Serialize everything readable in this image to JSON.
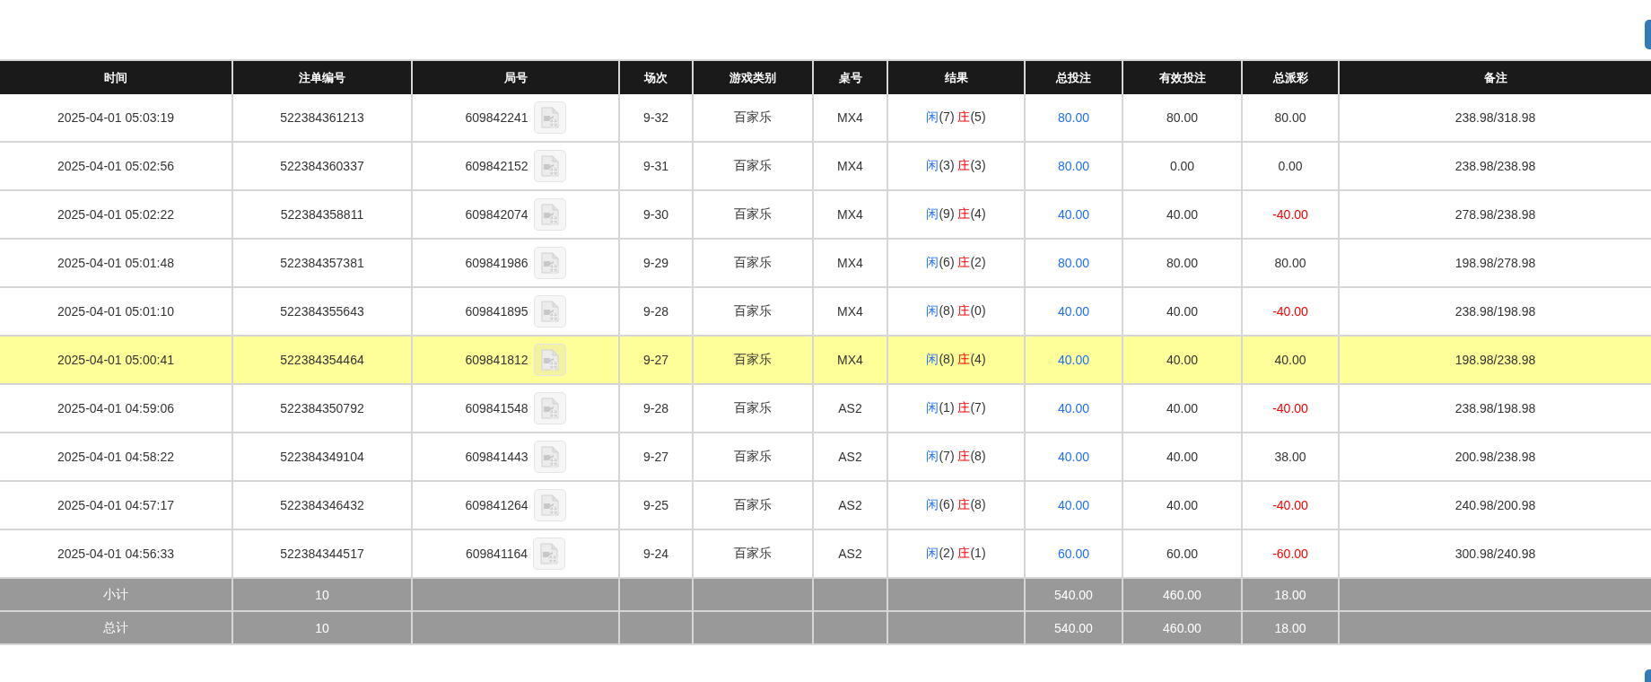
{
  "table": {
    "columns": [
      "时间",
      "注单编号",
      "局号",
      "场次",
      "游戏类别",
      "桌号",
      "结果",
      "总投注",
      "有效投注",
      "总派彩",
      "备注"
    ],
    "rows": [
      {
        "time": "2025-04-01 05:03:19",
        "bet_id": "522384361213",
        "round": "609842241",
        "session": "9-32",
        "game": "百家乐",
        "table": "MX4",
        "player": "闲",
        "player_points": "(7)",
        "banker": "庄",
        "banker_points": "(5)",
        "total_bet": "80.00",
        "valid_bet": "80.00",
        "payout": "80.00",
        "payout_negative": false,
        "note": "238.98/318.98",
        "selected": false
      },
      {
        "time": "2025-04-01 05:02:56",
        "bet_id": "522384360337",
        "round": "609842152",
        "session": "9-31",
        "game": "百家乐",
        "table": "MX4",
        "player": "闲",
        "player_points": "(3)",
        "banker": "庄",
        "banker_points": "(3)",
        "total_bet": "80.00",
        "valid_bet": "0.00",
        "payout": "0.00",
        "payout_negative": false,
        "note": "238.98/238.98",
        "selected": false
      },
      {
        "time": "2025-04-01 05:02:22",
        "bet_id": "522384358811",
        "round": "609842074",
        "session": "9-30",
        "game": "百家乐",
        "table": "MX4",
        "player": "闲",
        "player_points": "(9)",
        "banker": "庄",
        "banker_points": "(4)",
        "total_bet": "40.00",
        "valid_bet": "40.00",
        "payout": "-40.00",
        "payout_negative": true,
        "note": "278.98/238.98",
        "selected": false
      },
      {
        "time": "2025-04-01 05:01:48",
        "bet_id": "522384357381",
        "round": "609841986",
        "session": "9-29",
        "game": "百家乐",
        "table": "MX4",
        "player": "闲",
        "player_points": "(6)",
        "banker": "庄",
        "banker_points": "(2)",
        "total_bet": "80.00",
        "valid_bet": "80.00",
        "payout": "80.00",
        "payout_negative": false,
        "note": "198.98/278.98",
        "selected": false
      },
      {
        "time": "2025-04-01 05:01:10",
        "bet_id": "522384355643",
        "round": "609841895",
        "session": "9-28",
        "game": "百家乐",
        "table": "MX4",
        "player": "闲",
        "player_points": "(8)",
        "banker": "庄",
        "banker_points": "(0)",
        "total_bet": "40.00",
        "valid_bet": "40.00",
        "payout": "-40.00",
        "payout_negative": true,
        "note": "238.98/198.98",
        "selected": false
      },
      {
        "time": "2025-04-01 05:00:41",
        "bet_id": "522384354464",
        "round": "609841812",
        "session": "9-27",
        "game": "百家乐",
        "table": "MX4",
        "player": "闲",
        "player_points": "(8)",
        "banker": "庄",
        "banker_points": "(4)",
        "total_bet": "40.00",
        "valid_bet": "40.00",
        "payout": "40.00",
        "payout_negative": false,
        "note": "198.98/238.98",
        "selected": true
      },
      {
        "time": "2025-04-01 04:59:06",
        "bet_id": "522384350792",
        "round": "609841548",
        "session": "9-28",
        "game": "百家乐",
        "table": "AS2",
        "player": "闲",
        "player_points": "(1)",
        "banker": "庄",
        "banker_points": "(7)",
        "total_bet": "40.00",
        "valid_bet": "40.00",
        "payout": "-40.00",
        "payout_negative": true,
        "note": "238.98/198.98",
        "selected": false
      },
      {
        "time": "2025-04-01 04:58:22",
        "bet_id": "522384349104",
        "round": "609841443",
        "session": "9-27",
        "game": "百家乐",
        "table": "AS2",
        "player": "闲",
        "player_points": "(7)",
        "banker": "庄",
        "banker_points": "(8)",
        "total_bet": "40.00",
        "valid_bet": "40.00",
        "payout": "38.00",
        "payout_negative": false,
        "note": "200.98/238.98",
        "selected": false
      },
      {
        "time": "2025-04-01 04:57:17",
        "bet_id": "522384346432",
        "round": "609841264",
        "session": "9-25",
        "game": "百家乐",
        "table": "AS2",
        "player": "闲",
        "player_points": "(6)",
        "banker": "庄",
        "banker_points": "(8)",
        "total_bet": "40.00",
        "valid_bet": "40.00",
        "payout": "-40.00",
        "payout_negative": true,
        "note": "240.98/200.98",
        "selected": false
      },
      {
        "time": "2025-04-01 04:56:33",
        "bet_id": "522384344517",
        "round": "609841164",
        "session": "9-24",
        "game": "百家乐",
        "table": "AS2",
        "player": "闲",
        "player_points": "(2)",
        "banker": "庄",
        "banker_points": "(1)",
        "total_bet": "60.00",
        "valid_bet": "60.00",
        "payout": "-60.00",
        "payout_negative": true,
        "note": "300.98/240.98",
        "selected": false
      }
    ],
    "summary": [
      {
        "label": "小计",
        "count": "10",
        "total_bet": "540.00",
        "valid_bet": "460.00",
        "payout": "18.00"
      },
      {
        "label": "总计",
        "count": "10",
        "total_bet": "540.00",
        "valid_bet": "460.00",
        "payout": "18.00"
      }
    ]
  }
}
